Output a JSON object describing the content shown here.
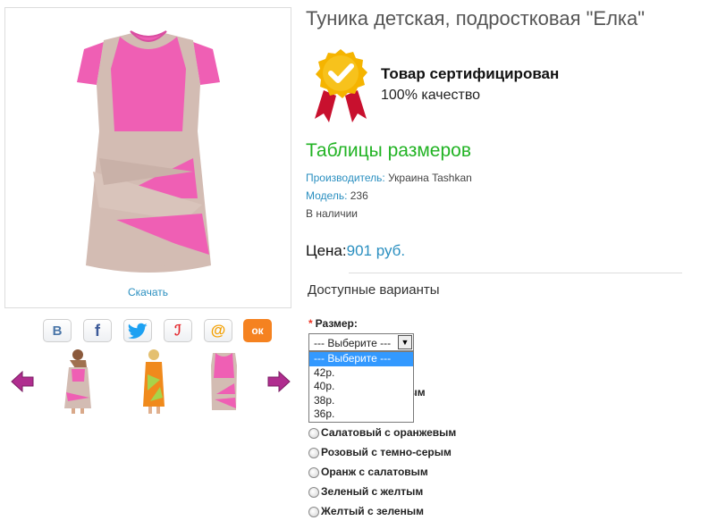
{
  "product": {
    "title": "Туника детская, подростковая \"Елка\"",
    "download_label": "Скачать"
  },
  "social": [
    {
      "name": "vk",
      "glyph": "B"
    },
    {
      "name": "facebook",
      "glyph": "f"
    },
    {
      "name": "twitter",
      "glyph": ""
    },
    {
      "name": "livejournal",
      "glyph": "ℐ"
    },
    {
      "name": "mail",
      "glyph": "@"
    },
    {
      "name": "odnoklassniki",
      "glyph": "ок"
    }
  ],
  "certificate": {
    "title": "Товар сертифицирован",
    "subtitle": "100% качество"
  },
  "size_table_link": "Таблицы размеров",
  "info": {
    "maker_label": "Производитель:",
    "maker_value": " Украина Tashkan",
    "model_label": "Модель:",
    "model_value": " 236",
    "stock": "В наличии"
  },
  "price": {
    "label": "Цена:",
    "value": "901 руб."
  },
  "options_title": "Доступные варианты",
  "size": {
    "required_mark": "*",
    "label": "Размер:",
    "selected": "--- Выберите ---",
    "options": [
      "--- Выберите ---",
      "42р.",
      "40р.",
      "38р.",
      "36р."
    ]
  },
  "colors": {
    "hidden_partial": "озовым",
    "items": [
      "Салатовый с оранжевым",
      "Розовый с темно-серым",
      "Оранж с салатовым",
      "Зеленый с желтым",
      "Желтый с зеленым"
    ]
  },
  "palette": {
    "pink": "#ef5fb4",
    "beige": "#d3bcb3",
    "green": "#22b324",
    "link_blue": "#2a8fc0",
    "arrow": "#b02d8f"
  }
}
